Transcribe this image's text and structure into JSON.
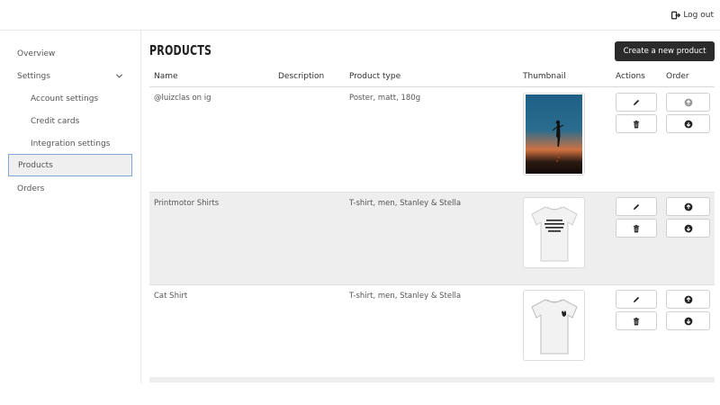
{
  "header": {
    "logout_label": "Log out"
  },
  "sidebar": {
    "items": [
      {
        "label": "Overview"
      },
      {
        "label": "Settings"
      },
      {
        "label": "Account settings"
      },
      {
        "label": "Credit cards"
      },
      {
        "label": "Integration settings"
      },
      {
        "label": "Products"
      },
      {
        "label": "Orders"
      }
    ]
  },
  "main": {
    "title": "PRODUCTS",
    "create_button": "Create a new product",
    "columns": {
      "name": "Name",
      "description": "Description",
      "product_type": "Product type",
      "thumbnail": "Thumbnail",
      "actions": "Actions",
      "order": "Order"
    },
    "rows": [
      {
        "name": "@luizclas on ig",
        "description": "",
        "product_type": "Poster, matt, 180g",
        "thumbnail": "silhouette-poster-image"
      },
      {
        "name": "Printmotor Shirts",
        "description": "",
        "product_type": "T-shirt, men, Stanley & Stella",
        "thumbnail": "white-tshirt-text-image"
      },
      {
        "name": "Cat Shirt",
        "description": "",
        "product_type": "T-shirt, men, Stanley & Stella",
        "thumbnail": "white-tshirt-cat-image"
      }
    ]
  },
  "colors": {
    "primary_button": "#2b2b2b",
    "active_border": "#7fa7d9",
    "alt_row": "#eeeeee"
  },
  "icons": [
    "logout-icon",
    "chevron-down-icon",
    "pencil-icon",
    "trash-icon",
    "arrow-up-circle-icon",
    "arrow-down-circle-icon"
  ]
}
